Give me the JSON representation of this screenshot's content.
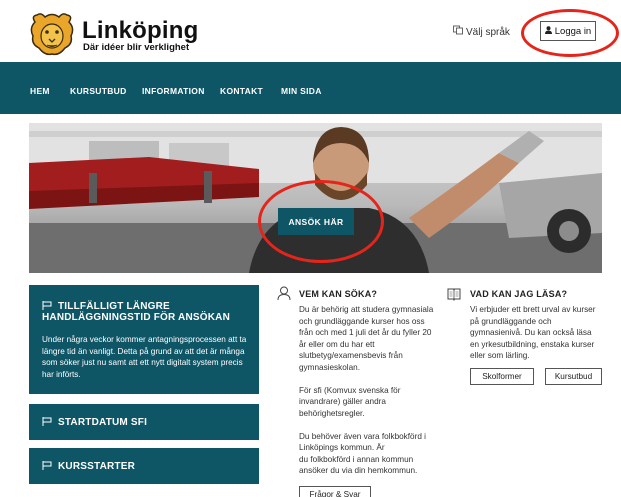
{
  "header": {
    "brand_name": "Linköping",
    "brand_tagline": "Där idéer blir verklighet",
    "language_label": "Välj språk",
    "login_label": "Logga in"
  },
  "nav": {
    "items": [
      {
        "label": "HEM"
      },
      {
        "label": "KURSUTBUD"
      },
      {
        "label": "INFORMATION"
      },
      {
        "label": "KONTAKT"
      },
      {
        "label": "MIN SIDA"
      }
    ]
  },
  "hero": {
    "apply_label": "ANSÖK HÄR"
  },
  "notice": {
    "title_line1": "TILLFÄLLIGT LÄNGRE",
    "title_line2": "HANDLÄGGNINGSTID FÖR ANSÖKAN",
    "body": "Under några veckor kommer antagningsprocessen att ta längre tid än vanligt. Detta på grund av att det är många som söker just nu samt att ett nytt digitalt system precis har införts."
  },
  "sfi_box": {
    "title": "STARTDATUM SFI"
  },
  "kurs_box": {
    "title": "KURSSTARTER"
  },
  "who_can_apply": {
    "title": "VEM KAN SÖKA?",
    "lines": [
      "Du är behörig att studera gymnasiala",
      "och grundläggande kurser hos oss",
      "från och med 1 juli det år du fyller 20",
      "år eller om du har ett",
      "slutbetyg/examensbevis från",
      "gymnasieskolan.",
      "",
      "För sfi (Komvux svenska för",
      "invandrare) gäller andra",
      "behörighetsregler.",
      "",
      "Du behöver även vara folkbokförd i",
      "Linköpings kommun. Är",
      "du folkbokförd i annan kommun",
      "ansöker du via din hemkommun."
    ],
    "faq_label": "Frågor & Svar"
  },
  "what_can_study": {
    "title": "VAD KAN JAG LÄSA?",
    "lines": [
      "Vi erbjuder ett brett urval av kurser",
      "på grundläggande och",
      "gymnasienivå. Du kan också läsa",
      "en yrkesutbildning, enstaka kurser",
      "eller som lärling."
    ],
    "btn_forms": "Skolformer",
    "btn_courses": "Kursutbud"
  },
  "colors": {
    "teal": "#0e5566",
    "annotation_red": "#e5251b",
    "lion_gold": "#e9a62a"
  }
}
